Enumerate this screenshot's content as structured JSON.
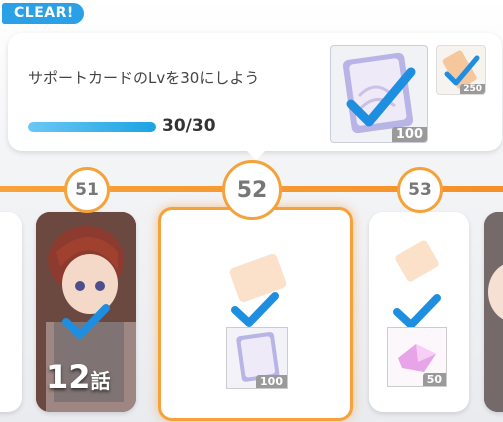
{
  "mission": {
    "badge": "CLEAR!",
    "text": "サポートカードのLvを30にしよう",
    "progress_text": "30/30",
    "progress_fraction": 1.0,
    "rewards": [
      {
        "icon": "support-card-icon",
        "quantity": "100"
      },
      {
        "icon": "ticket-icon",
        "quantity": "250"
      }
    ]
  },
  "levels": [
    "51",
    "52",
    "53"
  ],
  "cards": {
    "card_51": {
      "episode": "12",
      "episode_suffix": "話"
    },
    "card_52": {
      "icon": "support-card-icon",
      "quantity": "100"
    },
    "card_53": {
      "icon": "crystal-icon",
      "quantity": "50"
    }
  },
  "colors": {
    "accent": "#f6a23a",
    "check": "#1e8fe0",
    "clear": "#2aa0e6"
  }
}
